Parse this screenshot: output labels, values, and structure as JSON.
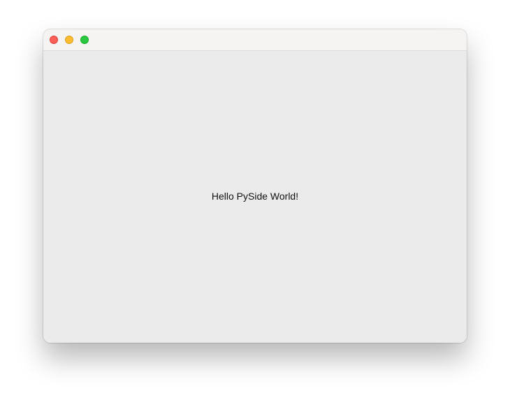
{
  "window": {
    "controls": [
      {
        "name": "close",
        "color": "#ff5f57"
      },
      {
        "name": "minimize",
        "color": "#febc2e"
      },
      {
        "name": "zoom",
        "color": "#28c840"
      }
    ]
  },
  "content": {
    "label_text": "Hello PySide World!"
  },
  "colors": {
    "window_bg": "#ebebeb",
    "titlebar_bg": "#f5f4f2"
  }
}
